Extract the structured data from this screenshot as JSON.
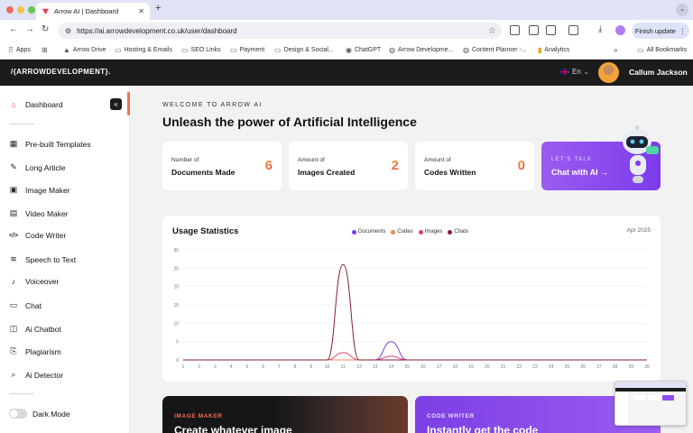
{
  "browser": {
    "tab_title": "Arrow AI | Dashboard",
    "url": "https://ai.arrowdevelopment.co.uk/user/dashboard",
    "finish_update": "Finish update",
    "bookmarks": [
      "Apps",
      "Arrow Drive",
      "Hosting & Emails",
      "SEO Links",
      "Payment",
      "Design & Social...",
      "ChatGPT",
      "Arrow Developme...",
      "Content Planner -...",
      "Analytics",
      "All Bookmarks"
    ]
  },
  "header": {
    "logo": "/{ARROWDEVELOPMENT}.",
    "language": "En",
    "user_name": "Callum Jackson"
  },
  "sidebar": {
    "items": [
      {
        "label": "Dashboard",
        "icon": "home-icon"
      },
      {
        "label": "Pre-built Templates",
        "icon": "grid-icon"
      },
      {
        "label": "Long Article",
        "icon": "pen-icon"
      },
      {
        "label": "Image Maker",
        "icon": "image-icon"
      },
      {
        "label": "Video Maker",
        "icon": "video-icon"
      },
      {
        "label": "Code Writer",
        "icon": "code-icon"
      },
      {
        "label": "Speech to Text",
        "icon": "waveform-icon"
      },
      {
        "label": "Voiceover",
        "icon": "microphone-icon"
      },
      {
        "label": "Chat",
        "icon": "chat-icon"
      },
      {
        "label": "Ai Chatbot",
        "icon": "chatbot-icon"
      },
      {
        "label": "Plagiarism",
        "icon": "plagiarism-icon"
      },
      {
        "label": "Ai Detector",
        "icon": "detector-icon"
      }
    ],
    "dark_mode_label": "Dark Mode",
    "dark_mode_on": false
  },
  "main": {
    "welcome": "WELCOME TO ARROW AI",
    "headline": "Unleash the power of Artificial Intelligence",
    "stats": [
      {
        "small": "Number of",
        "big": "Documents Made",
        "value": "6"
      },
      {
        "small": "Amount of",
        "big": "Images Created",
        "value": "2"
      },
      {
        "small": "Amount of",
        "big": "Codes Written",
        "value": "0"
      }
    ],
    "talk": {
      "small": "LET'S TALK",
      "big": "Chat with AI →"
    },
    "usage": {
      "title": "Usage Statistics",
      "date": "Apr 2025"
    },
    "promos": [
      {
        "label": "IMAGE MAKER",
        "title": "Create whatever image"
      },
      {
        "label": "CODE WRITER",
        "title": "Instantly get the code"
      }
    ]
  },
  "colors": {
    "accent": "#7c3bea",
    "documents": "#7c3bea",
    "codes": "#f0885a",
    "images": "#d9456b",
    "chats": "#8a1c2a"
  },
  "chart_data": {
    "type": "line",
    "title": "Usage Statistics",
    "x": [
      1,
      2,
      3,
      4,
      5,
      6,
      7,
      8,
      9,
      10,
      11,
      12,
      13,
      14,
      15,
      16,
      17,
      18,
      19,
      20,
      21,
      22,
      23,
      24,
      25,
      26,
      27,
      28,
      29,
      30
    ],
    "ylim": [
      0,
      30
    ],
    "y_ticks": [
      0,
      5,
      10,
      15,
      20,
      25,
      30
    ],
    "series": [
      {
        "name": "Documents",
        "color": "#7c3bea",
        "values": [
          0,
          0,
          0,
          0,
          0,
          0,
          0,
          0,
          0,
          0,
          0,
          0,
          0,
          5,
          0,
          0,
          0,
          0,
          0,
          0,
          0,
          0,
          0,
          0,
          0,
          0,
          0,
          0,
          0,
          0
        ]
      },
      {
        "name": "Codes",
        "color": "#f0885a",
        "values": [
          0,
          0,
          0,
          0,
          0,
          0,
          0,
          0,
          0,
          0,
          0,
          0,
          0,
          0,
          0,
          0,
          0,
          0,
          0,
          0,
          0,
          0,
          0,
          0,
          0,
          0,
          0,
          0,
          0,
          0
        ]
      },
      {
        "name": "Images",
        "color": "#d9456b",
        "values": [
          0,
          0,
          0,
          0,
          0,
          0,
          0,
          0,
          0,
          0,
          2,
          0,
          0,
          1,
          0,
          0,
          0,
          0,
          0,
          0,
          0,
          0,
          0,
          0,
          0,
          0,
          0,
          0,
          0,
          0
        ]
      },
      {
        "name": "Chats",
        "color": "#8a1c2a",
        "values": [
          0,
          0,
          0,
          0,
          0,
          0,
          0,
          0,
          0,
          0,
          26,
          0,
          0,
          0,
          0,
          0,
          0,
          0,
          0,
          0,
          0,
          0,
          0,
          0,
          0,
          0,
          0,
          0,
          0,
          0
        ]
      }
    ]
  }
}
